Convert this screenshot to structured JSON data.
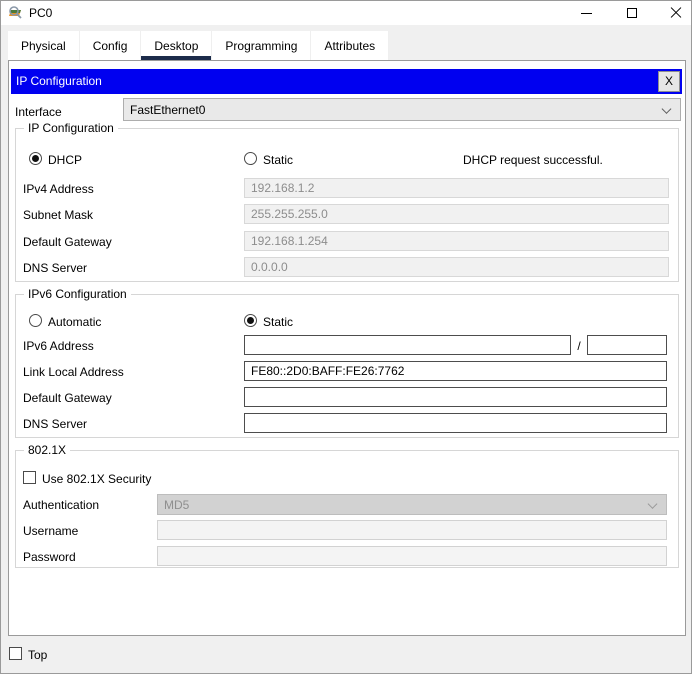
{
  "window": {
    "title": "PC0"
  },
  "tabs": [
    {
      "label": "Physical"
    },
    {
      "label": "Config"
    },
    {
      "label": "Desktop"
    },
    {
      "label": "Programming"
    },
    {
      "label": "Attributes"
    }
  ],
  "dialog": {
    "title": "IP Configuration",
    "close_label": "X"
  },
  "interface_row": {
    "label": "Interface",
    "value": "FastEthernet0"
  },
  "ipv4": {
    "legend": "IP Configuration",
    "dhcp_label": "DHCP",
    "static_label": "Static",
    "status": "DHCP request successful.",
    "rows": [
      {
        "label": "IPv4 Address",
        "value": "192.168.1.2"
      },
      {
        "label": "Subnet Mask",
        "value": "255.255.255.0"
      },
      {
        "label": "Default Gateway",
        "value": "192.168.1.254"
      },
      {
        "label": "DNS Server",
        "value": "0.0.0.0"
      }
    ]
  },
  "ipv6": {
    "legend": "IPv6 Configuration",
    "auto_label": "Automatic",
    "static_label": "Static",
    "address": {
      "label": "IPv6 Address",
      "value": "",
      "separator": "/",
      "prefix": ""
    },
    "link_local": {
      "label": "Link Local Address",
      "value": "FE80::2D0:BAFF:FE26:7762"
    },
    "gateway": {
      "label": "Default Gateway",
      "value": ""
    },
    "dns": {
      "label": "DNS Server",
      "value": ""
    }
  },
  "dot1x": {
    "legend": "802.1X",
    "checkbox_label": "Use 802.1X Security",
    "auth": {
      "label": "Authentication",
      "value": "MD5"
    },
    "username": {
      "label": "Username",
      "value": ""
    },
    "password": {
      "label": "Password",
      "value": ""
    }
  },
  "bottom": {
    "top_label": "Top"
  },
  "colors": {
    "dialog_header": "#0000f0",
    "active_tab_underline": "#1c2b4a",
    "panel_bg": "#f0f0f0"
  }
}
